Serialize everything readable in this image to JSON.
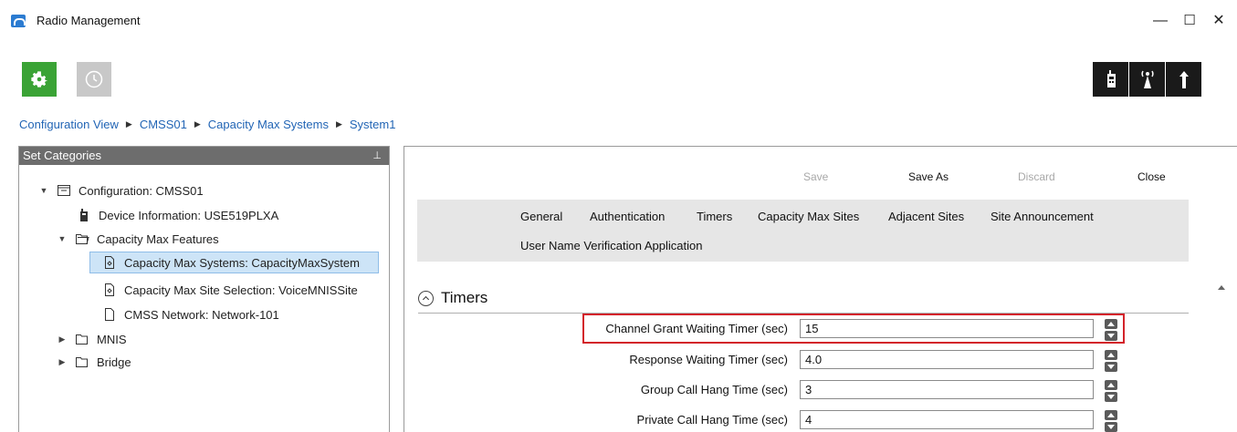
{
  "window": {
    "title": "Radio Management",
    "minimize": "—",
    "maximize": "☐",
    "close": "✕"
  },
  "breadcrumb": [
    "Configuration View",
    "CMSS01",
    "Capacity Max Systems",
    "System1"
  ],
  "left_panel": {
    "header": "Set Categories",
    "pin": "ᵽ",
    "tree": [
      {
        "label": "Configuration: CMSS01",
        "expanded": true,
        "icon": "configuration-icon"
      },
      {
        "label": "Device Information: USE519PLXA",
        "icon": "device-icon"
      },
      {
        "label": "Capacity Max Features",
        "expanded": true,
        "icon": "folder-open-icon"
      },
      {
        "label": "Capacity Max Systems: CapacityMaxSystem",
        "icon": "document-icon",
        "selected": true
      },
      {
        "label": "Capacity Max Site Selection: VoiceMNISSite",
        "icon": "document-icon"
      },
      {
        "label": "CMSS Network: Network-101",
        "icon": "blank-document-icon"
      },
      {
        "label": "MNIS",
        "expanded": false,
        "icon": "folder-icon"
      },
      {
        "label": "Bridge",
        "expanded": false,
        "icon": "folder-icon"
      }
    ]
  },
  "actions": {
    "save": "Save",
    "save_as": "Save As",
    "discard": "Discard",
    "close": "Close"
  },
  "tabs": [
    "General",
    "Authentication",
    "Timers",
    "Capacity Max Sites",
    "Adjacent Sites",
    "Site Announcement",
    "User Name Verification Application"
  ],
  "section": {
    "title": "Timers"
  },
  "fields": [
    {
      "label": "Channel Grant Waiting Timer (sec)",
      "value": "15"
    },
    {
      "label": "Response Waiting Timer (sec)",
      "value": "4.0"
    },
    {
      "label": "Group Call Hang Time (sec)",
      "value": "3"
    },
    {
      "label": "Private Call Hang Time (sec)",
      "value": "4"
    }
  ],
  "colors": {
    "accent_green": "#3aa335",
    "link_blue": "#2265b5",
    "highlight_red": "#d3232a",
    "panel_header": "#6d6d6d"
  }
}
